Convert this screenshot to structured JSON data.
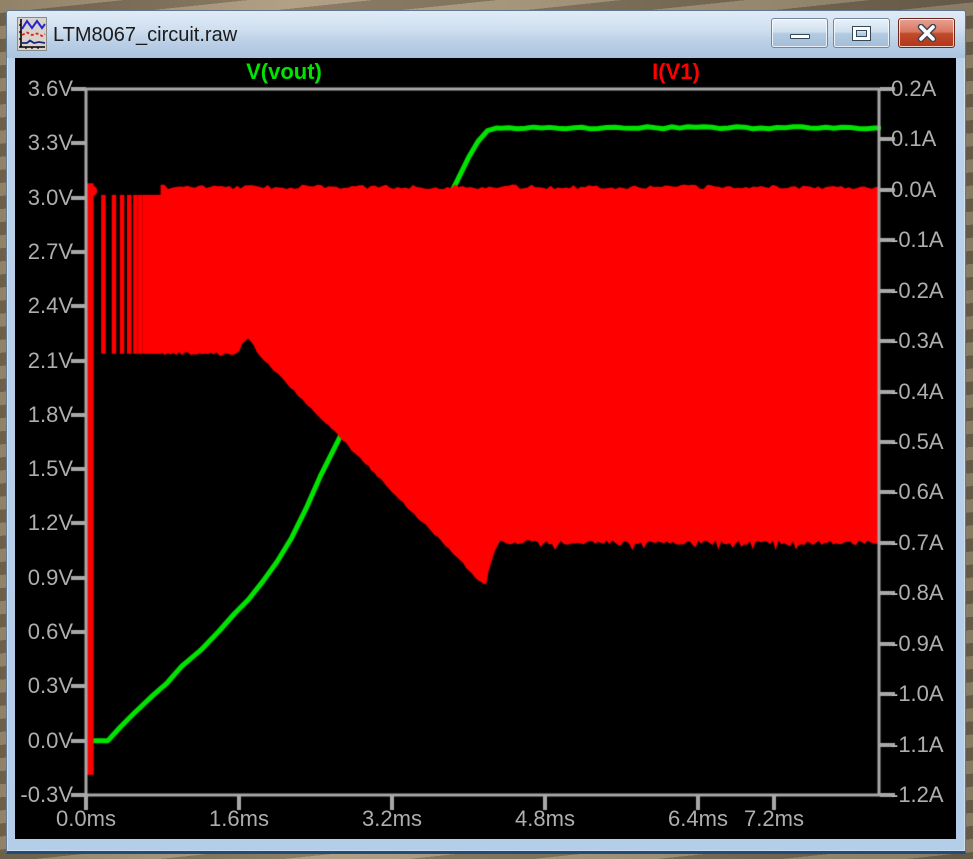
{
  "window": {
    "title": "LTM8067_circuit.raw",
    "icon": "waveform-plot-icon",
    "controls": {
      "minimize": "minimize",
      "maximize": "maximize",
      "close": "close"
    }
  },
  "plot": {
    "background_color": "#000000",
    "axis_color": "#a8a8a8",
    "label_color": "#aeaeae",
    "trace_labels": [
      {
        "text": "V(vout)",
        "color": "#00e400"
      },
      {
        "text": "I(V1)",
        "color": "#ff0000"
      }
    ]
  },
  "chart_data": {
    "type": "line",
    "title": "",
    "x_axis": {
      "unit": "ms",
      "tick_labels": [
        "0.0ms",
        "1.6ms",
        "3.2ms",
        "4.8ms",
        "6.4ms",
        "7.2ms"
      ],
      "tick_values": [
        0.0,
        1.6,
        3.2,
        4.8,
        6.4,
        7.2
      ],
      "range": [
        0,
        8.295
      ],
      "grid": false
    },
    "y_axis_left": {
      "unit": "V",
      "tick_labels": [
        "3.6V",
        "3.3V",
        "3.0V",
        "2.7V",
        "2.4V",
        "2.1V",
        "1.8V",
        "1.5V",
        "1.2V",
        "0.9V",
        "0.6V",
        "0.3V",
        "0.0V",
        "-0.3V"
      ],
      "tick_values": [
        3.6,
        3.3,
        3.0,
        2.7,
        2.4,
        2.1,
        1.8,
        1.5,
        1.2,
        0.9,
        0.6,
        0.3,
        0.0,
        -0.3
      ],
      "range": [
        -0.3,
        3.6
      ]
    },
    "y_axis_right": {
      "unit": "A",
      "tick_labels": [
        "0.2A",
        "0.1A",
        "0.0A",
        "-0.1A",
        "-0.2A",
        "-0.3A",
        "-0.4A",
        "-0.5A",
        "-0.6A",
        "-0.7A",
        "-0.8A",
        "-0.9A",
        "-1.0A",
        "-1.1A",
        "-1.2A"
      ],
      "tick_values": [
        0.2,
        0.1,
        0.0,
        -0.1,
        -0.2,
        -0.3,
        -0.4,
        -0.5,
        -0.6,
        -0.7,
        -0.8,
        -0.9,
        -1.0,
        -1.1,
        -1.2
      ],
      "range": [
        -1.2,
        0.2
      ]
    },
    "series": [
      {
        "name": "V(vout)",
        "color": "#00e400",
        "axis": "left",
        "render": "line",
        "points_t_v": [
          [
            0.0,
            0.0
          ],
          [
            0.23,
            0.0
          ],
          [
            0.35,
            0.07
          ],
          [
            0.5,
            0.15
          ],
          [
            0.7,
            0.25
          ],
          [
            0.85,
            0.32
          ],
          [
            1.0,
            0.41
          ],
          [
            1.2,
            0.5
          ],
          [
            1.4,
            0.61
          ],
          [
            1.55,
            0.7
          ],
          [
            1.7,
            0.78
          ],
          [
            1.85,
            0.88
          ],
          [
            2.0,
            0.99
          ],
          [
            2.15,
            1.12
          ],
          [
            2.3,
            1.28
          ],
          [
            2.45,
            1.46
          ],
          [
            2.64,
            1.66
          ],
          [
            3.0,
            2.08
          ],
          [
            3.4,
            2.55
          ],
          [
            3.7,
            2.9
          ],
          [
            3.87,
            3.08
          ],
          [
            4.0,
            3.22
          ],
          [
            4.1,
            3.31
          ],
          [
            4.2,
            3.37
          ],
          [
            4.3,
            3.385
          ],
          [
            8.295,
            3.385
          ]
        ],
        "final_value_v": 3.385
      },
      {
        "name": "I(V1)",
        "color": "#ff0000",
        "axis": "right",
        "render": "switching-band",
        "description": "dense switching current drawn as a solid envelope band",
        "inrush_spike": {
          "t_start": 0.0,
          "t_end": 0.07,
          "top_a": 0.013,
          "bottom_a": -1.16
        },
        "startup_pulses": {
          "t_list": [
            0.18,
            0.29,
            0.375,
            0.45,
            0.515,
            0.565,
            0.61,
            0.65,
            0.685,
            0.715,
            0.74,
            0.762
          ],
          "top_a": -0.01,
          "bottom_a": -0.325
        },
        "band_t_start": 0.78,
        "top_envelope_a": 0.006,
        "bottom_envelope_t_a": [
          [
            0.78,
            -0.325
          ],
          [
            1.6,
            -0.325
          ],
          [
            1.64,
            -0.298
          ],
          [
            1.73,
            -0.298
          ],
          [
            1.8,
            -0.325
          ],
          [
            4.18,
            -0.788
          ],
          [
            4.24,
            -0.735
          ],
          [
            4.32,
            -0.7
          ],
          [
            8.295,
            -0.7
          ]
        ]
      }
    ],
    "legend_position": "top-inline"
  }
}
